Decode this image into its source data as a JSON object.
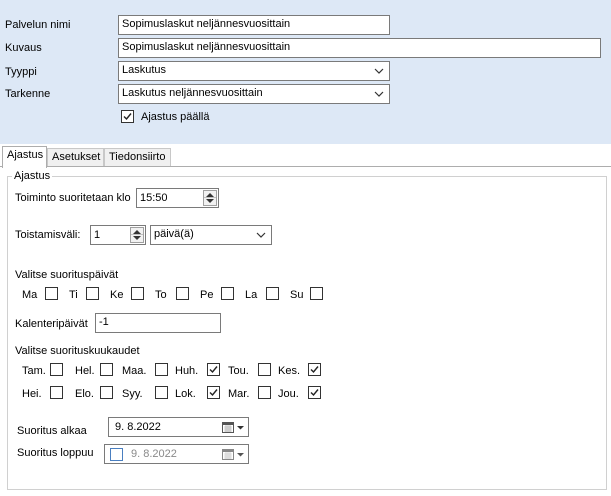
{
  "form": {
    "service_name_label": "Palvelun nimi",
    "service_name_value": "Sopimuslaskut neljännesvuosittain",
    "description_label": "Kuvaus",
    "description_value": "Sopimuslaskut neljännesvuosittain",
    "type_label": "Tyyppi",
    "type_value": "Laskutus",
    "specifier_label": "Tarkenne",
    "specifier_value": "Laskutus neljännesvuosittain",
    "scheduling_on_label": "Ajastus päällä",
    "scheduling_on_checked": true
  },
  "tabs": [
    {
      "label": "Ajastus",
      "active": true
    },
    {
      "label": "Asetukset",
      "active": false
    },
    {
      "label": "Tiedonsiirto",
      "active": false
    }
  ],
  "schedule": {
    "group_title": "Ajastus",
    "run_time_label": "Toiminto suoritetaan klo",
    "run_time_value": "15:50",
    "repeat_label": "Toistamisväli:",
    "repeat_value": "1",
    "repeat_unit": "päivä(ä)",
    "weekdays_title": "Valitse suorituspäivät",
    "weekdays": [
      {
        "label": "Ma",
        "checked": false
      },
      {
        "label": "Ti",
        "checked": false
      },
      {
        "label": "Ke",
        "checked": false
      },
      {
        "label": "To",
        "checked": false
      },
      {
        "label": "Pe",
        "checked": false
      },
      {
        "label": "La",
        "checked": false
      },
      {
        "label": "Su",
        "checked": false
      }
    ],
    "calendar_days_label": "Kalenteripäivät",
    "calendar_days_value": "-1",
    "months_title": "Valitse suorituskuukaudet",
    "months": [
      {
        "label": "Tam.",
        "checked": false
      },
      {
        "label": "Hel.",
        "checked": false
      },
      {
        "label": "Maa.",
        "checked": false
      },
      {
        "label": "Huh.",
        "checked": true
      },
      {
        "label": "Tou.",
        "checked": false
      },
      {
        "label": "Kes.",
        "checked": true
      },
      {
        "label": "Hei.",
        "checked": false
      },
      {
        "label": "Elo.",
        "checked": false
      },
      {
        "label": "Syy.",
        "checked": false
      },
      {
        "label": "Lok.",
        "checked": true
      },
      {
        "label": "Mar.",
        "checked": false
      },
      {
        "label": "Jou.",
        "checked": true
      }
    ],
    "start_label": "Suoritus alkaa",
    "start_value": "9.  8.2022",
    "end_label": "Suoritus loppuu",
    "end_value": "9.  8.2022",
    "end_enabled": false
  },
  "colors": {
    "top_panel_bg": "#dde8f6",
    "checkmark": "#222222",
    "disabled_text": "#8a8a8a"
  }
}
